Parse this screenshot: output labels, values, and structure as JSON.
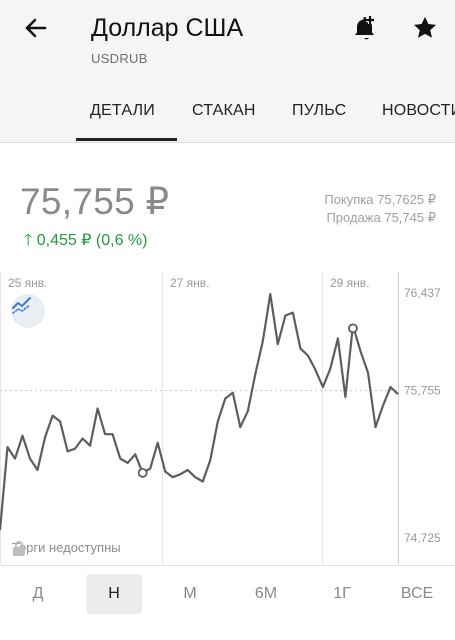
{
  "header": {
    "title": "Доллар США",
    "ticker": "USDRUB"
  },
  "tabs": [
    {
      "label": "ДЕТАЛИ",
      "active": true
    },
    {
      "label": "СТАКАН"
    },
    {
      "label": "ПУЛЬС"
    },
    {
      "label": "НОВОСТИ"
    }
  ],
  "quote": {
    "price": "75,755 ₽",
    "change": "0,455 ₽ (0,6 %)",
    "buy_label": "Покупка",
    "buy_value": "75,7625 ₽",
    "sell_label": "Продажа",
    "sell_value": "75,745 ₽"
  },
  "chart_data": {
    "type": "line",
    "x_labels": [
      "25 янв.",
      "27 янв.",
      "29 янв."
    ],
    "y_ticks": [
      "76,437",
      "75,755",
      "74,725"
    ],
    "ylim": [
      74.725,
      76.437
    ],
    "series": [
      {
        "values": [
          74.78,
          75.36,
          75.28,
          75.44,
          75.28,
          75.2,
          75.43,
          75.58,
          75.54,
          75.33,
          75.35,
          75.42,
          75.37,
          75.63,
          75.45,
          75.45,
          75.28,
          75.25,
          75.31,
          75.18,
          75.21,
          75.39,
          75.19,
          75.15,
          75.17,
          75.2,
          75.15,
          75.12,
          75.27,
          75.54,
          75.7,
          75.74,
          75.5,
          75.61,
          75.87,
          76.1,
          76.43,
          76.08,
          76.28,
          76.3,
          76.05,
          76.0,
          75.9,
          75.78,
          75.91,
          76.12,
          75.71,
          76.21,
          76.03,
          75.88,
          75.5,
          75.65,
          75.78,
          75.73
        ]
      }
    ],
    "markers": [
      {
        "label": "low",
        "value": 75.18
      },
      {
        "label": "high",
        "value": 76.19
      }
    ],
    "current_value": 75.755,
    "grid": true
  },
  "chart": {
    "trading_note": "Торги недоступны"
  },
  "periods": [
    {
      "label": "Д"
    },
    {
      "label": "Н",
      "active": true
    },
    {
      "label": "М"
    },
    {
      "label": "6М"
    },
    {
      "label": "1Г"
    },
    {
      "label": "ВСЕ"
    }
  ],
  "colors": {
    "accent_green": "#1e9e3e",
    "line": "#5a5e63",
    "indicator_blue": "#3b7be0"
  },
  "icons": {
    "back": "arrow-left-icon",
    "bell": "bell-plus-icon",
    "star": "star-icon",
    "indicator": "trend-indicator-icon",
    "lock": "lock-icon"
  }
}
